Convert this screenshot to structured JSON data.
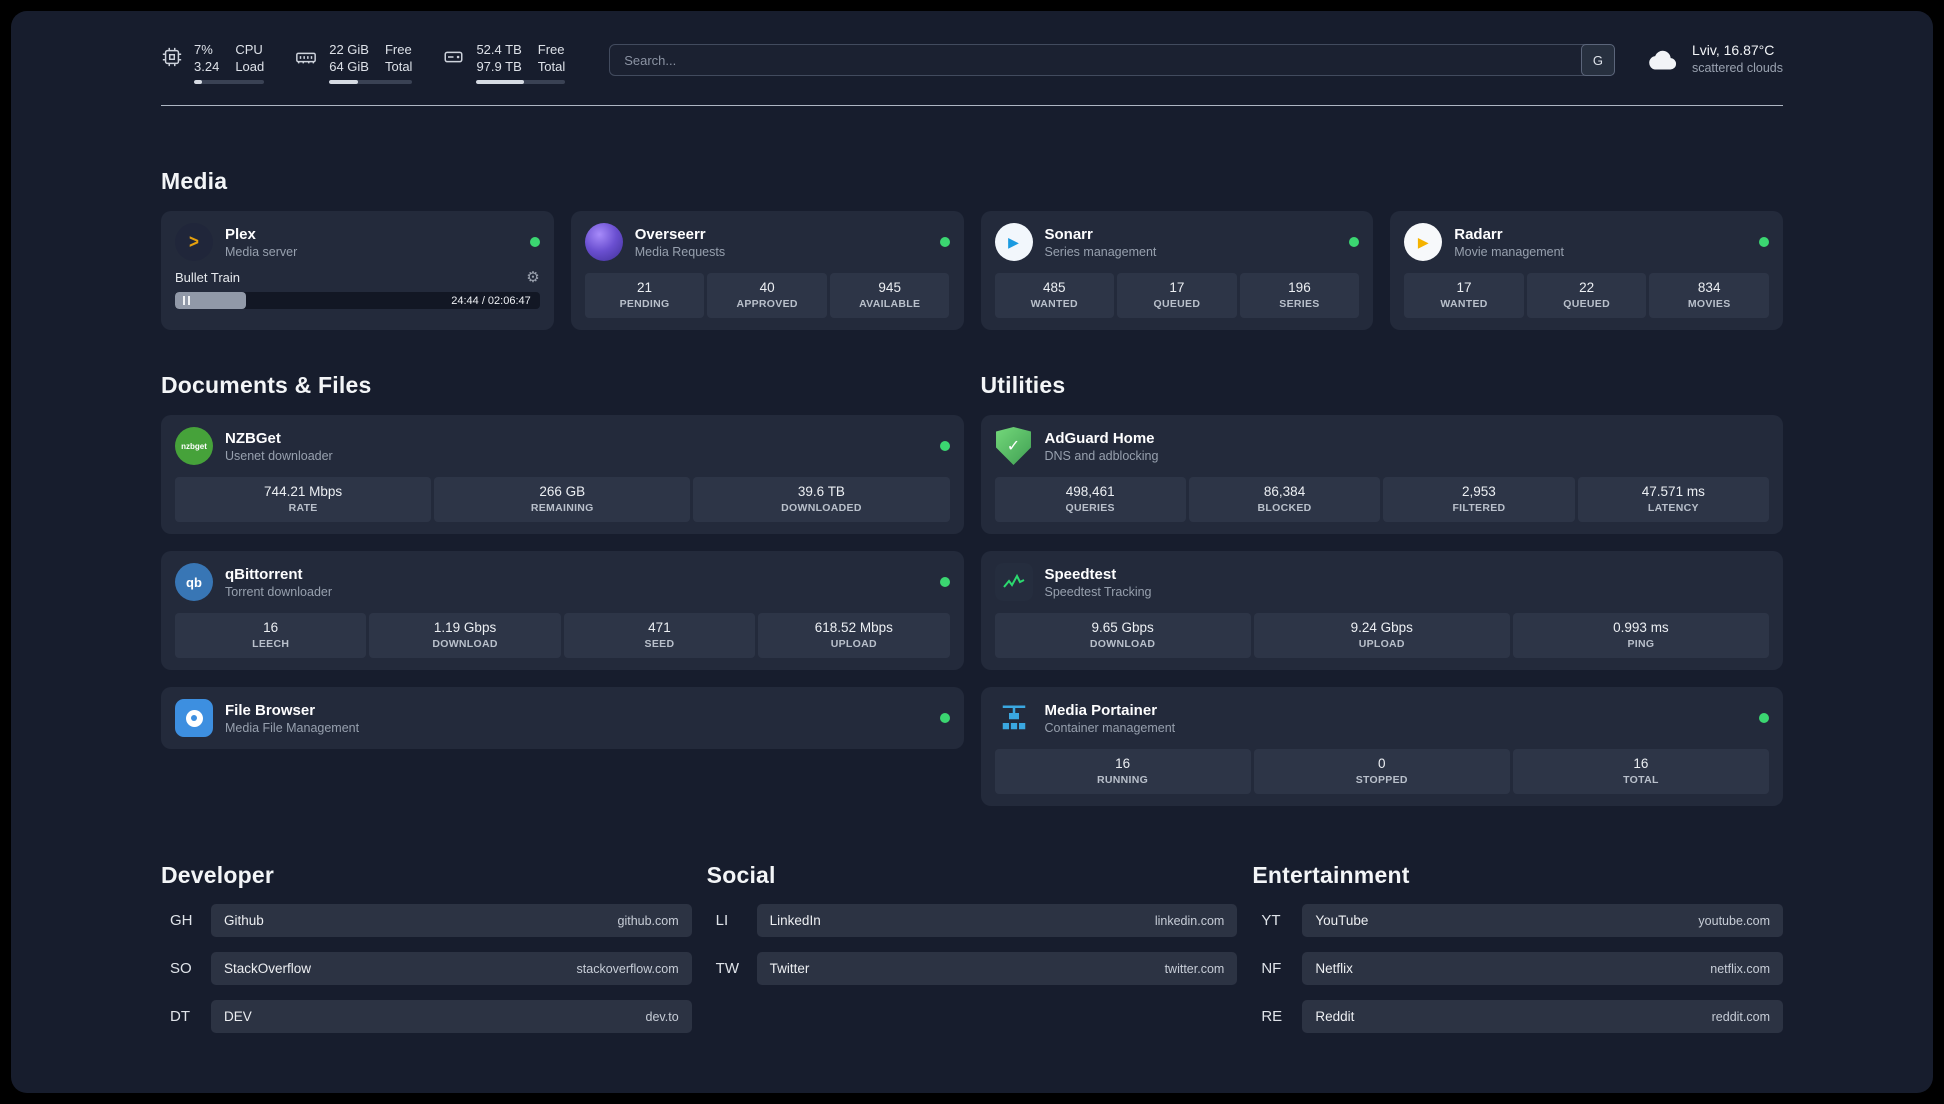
{
  "header": {
    "cpu": {
      "line1": "7%",
      "line2": "3.24",
      "label1": "CPU",
      "label2": "Load",
      "bar": 12
    },
    "ram": {
      "line1": "22 GiB",
      "line2": "64 GiB",
      "label1": "Free",
      "label2": "Total",
      "bar": 34
    },
    "disk": {
      "line1": "52.4 TB",
      "line2": "97.9 TB",
      "label1": "Free",
      "label2": "Total",
      "bar": 54
    },
    "search": {
      "placeholder": "Search...",
      "button_label": "G"
    },
    "weather": {
      "location": "Lviv, 16.87°C",
      "condition": "scattered clouds"
    }
  },
  "media": {
    "title": "Media",
    "plex": {
      "name": "Plex",
      "subtitle": "Media server",
      "now_playing": "Bullet Train",
      "time": "24:44 / 02:06:47",
      "progress": 19.5
    },
    "overseerr": {
      "name": "Overseerr",
      "subtitle": "Media Requests",
      "stats": [
        {
          "value": "21",
          "label": "PENDING"
        },
        {
          "value": "40",
          "label": "APPROVED"
        },
        {
          "value": "945",
          "label": "AVAILABLE"
        }
      ]
    },
    "sonarr": {
      "name": "Sonarr",
      "subtitle": "Series management",
      "stats": [
        {
          "value": "485",
          "label": "WANTED"
        },
        {
          "value": "17",
          "label": "QUEUED"
        },
        {
          "value": "196",
          "label": "SERIES"
        }
      ]
    },
    "radarr": {
      "name": "Radarr",
      "subtitle": "Movie management",
      "stats": [
        {
          "value": "17",
          "label": "WANTED"
        },
        {
          "value": "22",
          "label": "QUEUED"
        },
        {
          "value": "834",
          "label": "MOVIES"
        }
      ]
    }
  },
  "documents": {
    "title": "Documents & Files",
    "nzbget": {
      "name": "NZBGet",
      "subtitle": "Usenet downloader",
      "icon_text": "nzbget",
      "stats": [
        {
          "value": "744.21 Mbps",
          "label": "RATE"
        },
        {
          "value": "266 GB",
          "label": "REMAINING"
        },
        {
          "value": "39.6 TB",
          "label": "DOWNLOADED"
        }
      ]
    },
    "qbittorrent": {
      "name": "qBittorrent",
      "subtitle": "Torrent downloader",
      "icon_text": "qb",
      "stats": [
        {
          "value": "16",
          "label": "LEECH"
        },
        {
          "value": "1.19 Gbps",
          "label": "DOWNLOAD"
        },
        {
          "value": "471",
          "label": "SEED"
        },
        {
          "value": "618.52 Mbps",
          "label": "UPLOAD"
        }
      ]
    },
    "filebrowser": {
      "name": "File Browser",
      "subtitle": "Media File Management"
    }
  },
  "utilities": {
    "title": "Utilities",
    "adguard": {
      "name": "AdGuard Home",
      "subtitle": "DNS and adblocking",
      "stats": [
        {
          "value": "498,461",
          "label": "QUERIES"
        },
        {
          "value": "86,384",
          "label": "BLOCKED"
        },
        {
          "value": "2,953",
          "label": "FILTERED"
        },
        {
          "value": "47.571 ms",
          "label": "LATENCY"
        }
      ]
    },
    "speedtest": {
      "name": "Speedtest",
      "subtitle": "Speedtest Tracking",
      "stats": [
        {
          "value": "9.65 Gbps",
          "label": "DOWNLOAD"
        },
        {
          "value": "9.24 Gbps",
          "label": "UPLOAD"
        },
        {
          "value": "0.993 ms",
          "label": "PING"
        }
      ]
    },
    "portainer": {
      "name": "Media Portainer",
      "subtitle": "Container management",
      "stats": [
        {
          "value": "16",
          "label": "RUNNING"
        },
        {
          "value": "0",
          "label": "STOPPED"
        },
        {
          "value": "16",
          "label": "TOTAL"
        }
      ]
    }
  },
  "bookmarks": {
    "developer": {
      "title": "Developer",
      "items": [
        {
          "abbr": "GH",
          "name": "Github",
          "url": "github.com"
        },
        {
          "abbr": "SO",
          "name": "StackOverflow",
          "url": "stackoverflow.com"
        },
        {
          "abbr": "DT",
          "name": "DEV",
          "url": "dev.to"
        }
      ]
    },
    "social": {
      "title": "Social",
      "items": [
        {
          "abbr": "LI",
          "name": "LinkedIn",
          "url": "linkedin.com"
        },
        {
          "abbr": "TW",
          "name": "Twitter",
          "url": "twitter.com"
        }
      ]
    },
    "entertainment": {
      "title": "Entertainment",
      "items": [
        {
          "abbr": "YT",
          "name": "YouTube",
          "url": "youtube.com"
        },
        {
          "abbr": "NF",
          "name": "Netflix",
          "url": "netflix.com"
        },
        {
          "abbr": "RE",
          "name": "Reddit",
          "url": "reddit.com"
        }
      ]
    }
  },
  "colors": {
    "status_online": "#3bd671",
    "page_bg": "#171d2d",
    "card_bg": "#232a3b",
    "tile_bg": "#2d3547"
  }
}
